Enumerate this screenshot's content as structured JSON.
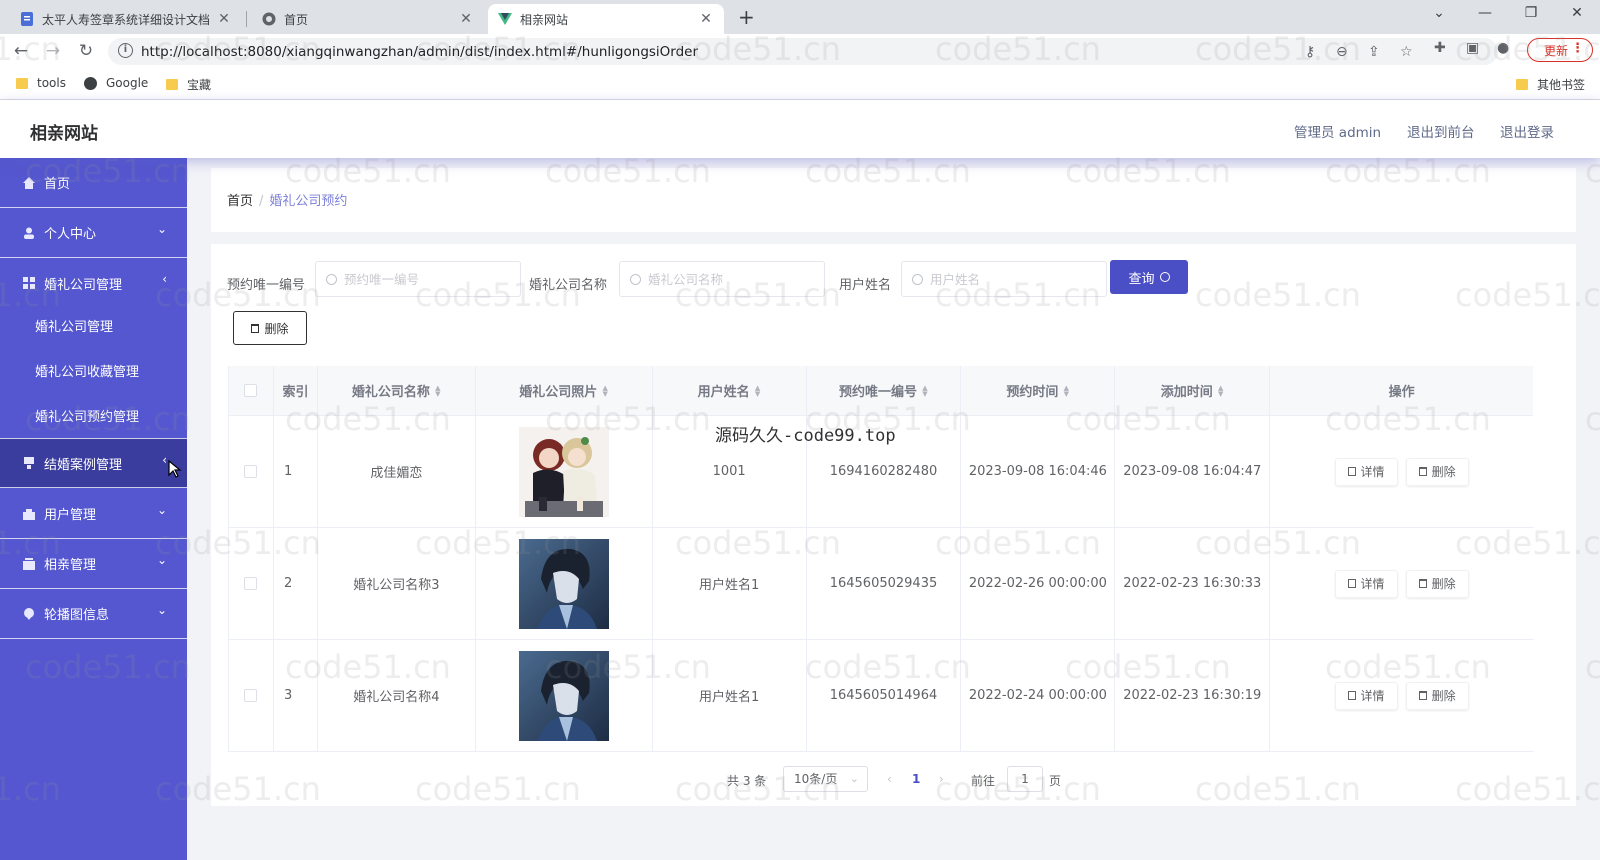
{
  "browser": {
    "tabs": [
      {
        "title": "太平人寿签章系统详细设计文档"
      },
      {
        "title": "首页"
      },
      {
        "title": "相亲网站"
      }
    ],
    "url": "http://localhost:8080/xiangqinwangzhan/admin/dist/index.html#/hunligongsiOrder",
    "update_label": "更新",
    "bookmarks": [
      "tools",
      "Google",
      "宝藏"
    ],
    "other_bookmarks": "其他书签"
  },
  "app": {
    "brand": "相亲网站",
    "topnav": {
      "user": "管理员 admin",
      "front": "退出到前台",
      "logout": "退出登录"
    }
  },
  "sidebar": {
    "items": [
      {
        "label": "首页",
        "icon": "home-icon"
      },
      {
        "label": "个人中心",
        "icon": "user-icon"
      },
      {
        "label": "婚礼公司管理",
        "icon": "grid-icon"
      },
      {
        "label": "结婚案例管理",
        "icon": "list-icon"
      },
      {
        "label": "用户管理",
        "icon": "users-icon"
      },
      {
        "label": "相亲管理",
        "icon": "box-icon"
      },
      {
        "label": "轮播图信息",
        "icon": "pin-icon"
      }
    ],
    "subitems": [
      "婚礼公司管理",
      "婚礼公司收藏管理",
      "婚礼公司预约管理"
    ]
  },
  "breadcrumb": {
    "home": "首页",
    "current": "婚礼公司预约"
  },
  "filters": {
    "order_no": {
      "label": "预约唯一编号",
      "placeholder": "预约唯一编号"
    },
    "company": {
      "label": "婚礼公司名称",
      "placeholder": "婚礼公司名称"
    },
    "username": {
      "label": "用户姓名",
      "placeholder": "用户姓名"
    },
    "query_label": "查询",
    "delete_label": "删除"
  },
  "table": {
    "headers": [
      "索引",
      "婚礼公司名称",
      "婚礼公司照片",
      "用户姓名",
      "预约唯一编号",
      "预约时间",
      "添加时间",
      "操作"
    ],
    "rows": [
      {
        "index": "1",
        "company": "成佳媚恋",
        "username": "1001",
        "order_no": "1694160282480",
        "booking_time": "2023-09-08 16:04:46",
        "added_time": "2023-09-08 16:04:47"
      },
      {
        "index": "2",
        "company": "婚礼公司名称3",
        "username": "用户姓名1",
        "order_no": "1645605029435",
        "booking_time": "2022-02-26 00:00:00",
        "added_time": "2022-02-23 16:30:33"
      },
      {
        "index": "3",
        "company": "婚礼公司名称4",
        "username": "用户姓名1",
        "order_no": "1645605014964",
        "booking_time": "2022-02-24 00:00:00",
        "added_time": "2022-02-23 16:30:19"
      }
    ],
    "detail_label": "详情",
    "delete_label": "删除"
  },
  "overlay_text": "源码久久-code99.top",
  "pagination": {
    "total": "共 3 条",
    "page_size": "10条/页",
    "current_page": "1",
    "goto": "前往",
    "goto_value": "1",
    "page_unit": "页"
  },
  "watermark": "code51.cn",
  "colors": {
    "sidebar": "#5457cf",
    "accent": "#4b4fc6",
    "breadcrumb_current": "#7d80d8"
  }
}
